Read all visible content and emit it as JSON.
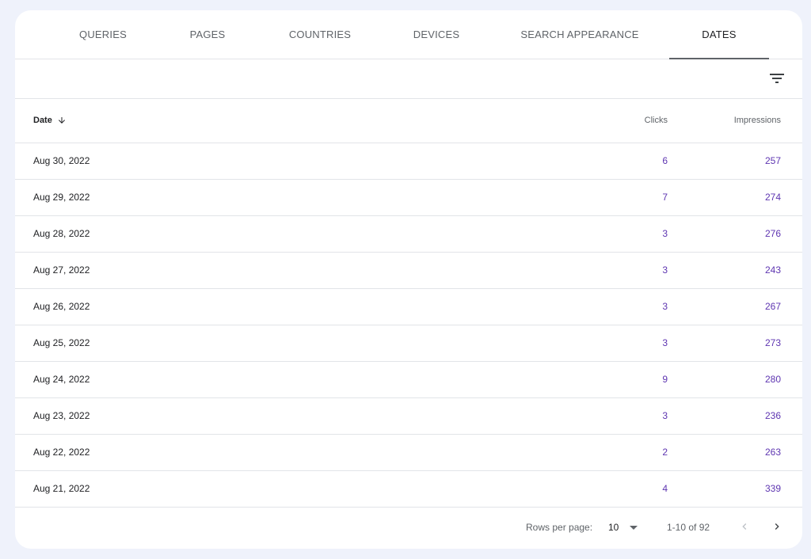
{
  "tabs": [
    {
      "label": "QUERIES",
      "active": false
    },
    {
      "label": "PAGES",
      "active": false
    },
    {
      "label": "COUNTRIES",
      "active": false
    },
    {
      "label": "DEVICES",
      "active": false
    },
    {
      "label": "SEARCH APPEARANCE",
      "active": false
    },
    {
      "label": "DATES",
      "active": true
    }
  ],
  "toolbar": {
    "filter_icon": "filter-list-icon"
  },
  "table": {
    "headers": {
      "date": "Date",
      "clicks": "Clicks",
      "impressions": "Impressions"
    },
    "sort": {
      "column": "date",
      "direction": "descending",
      "icon": "arrow-down-icon"
    },
    "rows": [
      {
        "date": "Aug 30, 2022",
        "clicks": "6",
        "impressions": "257"
      },
      {
        "date": "Aug 29, 2022",
        "clicks": "7",
        "impressions": "274"
      },
      {
        "date": "Aug 28, 2022",
        "clicks": "3",
        "impressions": "276"
      },
      {
        "date": "Aug 27, 2022",
        "clicks": "3",
        "impressions": "243"
      },
      {
        "date": "Aug 26, 2022",
        "clicks": "3",
        "impressions": "267"
      },
      {
        "date": "Aug 25, 2022",
        "clicks": "3",
        "impressions": "273"
      },
      {
        "date": "Aug 24, 2022",
        "clicks": "9",
        "impressions": "280"
      },
      {
        "date": "Aug 23, 2022",
        "clicks": "3",
        "impressions": "236"
      },
      {
        "date": "Aug 22, 2022",
        "clicks": "2",
        "impressions": "263"
      },
      {
        "date": "Aug 21, 2022",
        "clicks": "4",
        "impressions": "339"
      }
    ]
  },
  "pagination": {
    "rows_per_page_label": "Rows per page:",
    "rows_per_page_value": "10",
    "range": "1-10 of 92"
  },
  "colors": {
    "background": "#eff2fb",
    "card": "#ffffff",
    "metric_text": "#5e35b1",
    "divider": "#e2e4e8"
  }
}
